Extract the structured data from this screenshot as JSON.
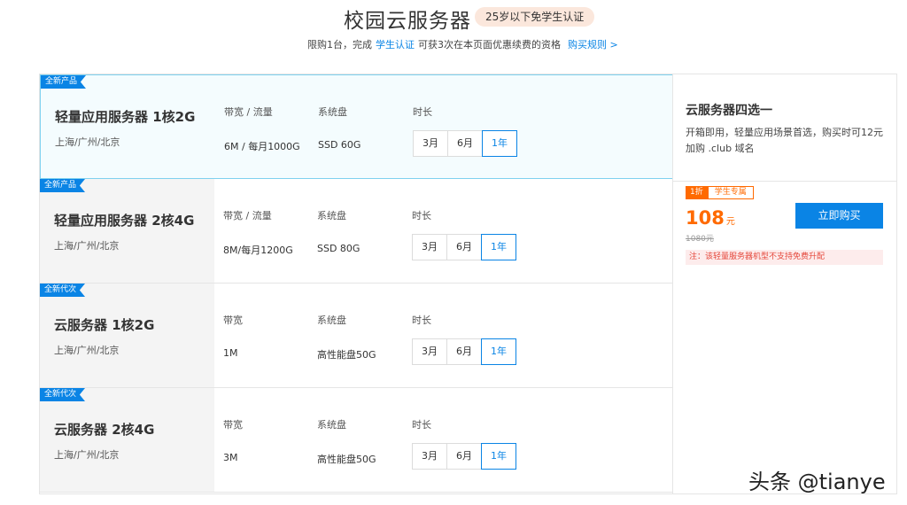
{
  "header": {
    "title": "校园云服务器",
    "badge": "25岁以下免学生认证",
    "subtitle_prefix": "限购1台，完成",
    "subtitle_link": "学生认证",
    "subtitle_middle": "可获3次在本页面优惠续费的资格",
    "subtitle_rules": "购买规则 >"
  },
  "products": [
    {
      "tag": "全新产品",
      "name": "轻量应用服务器 1核2G",
      "region": "上海/广州/北京",
      "bw_label": "带宽 / 流量",
      "bw_value": "6M / 每月1000G",
      "disk_label": "系统盘",
      "disk_value": "SSD 60G",
      "dur_label": "时长",
      "durations": [
        "3月",
        "6月",
        "1年"
      ]
    },
    {
      "tag": "全新产品",
      "name": "轻量应用服务器 2核4G",
      "region": "上海/广州/北京",
      "bw_label": "带宽 / 流量",
      "bw_value": "8M/每月1200G",
      "disk_label": "系统盘",
      "disk_value": "SSD 80G",
      "dur_label": "时长",
      "durations": [
        "3月",
        "6月",
        "1年"
      ]
    },
    {
      "tag": "全新代次",
      "name": "云服务器 1核2G",
      "region": "上海/广州/北京",
      "bw_label": "带宽",
      "bw_value": "1M",
      "disk_label": "系统盘",
      "disk_value": "高性能盘50G",
      "dur_label": "时长",
      "durations": [
        "3月",
        "6月",
        "1年"
      ]
    },
    {
      "tag": "全新代次",
      "name": "云服务器 2核4G",
      "region": "上海/广州/北京",
      "bw_label": "带宽",
      "bw_value": "3M",
      "disk_label": "系统盘",
      "disk_value": "高性能盘50G",
      "dur_label": "时长",
      "durations": [
        "3月",
        "6月",
        "1年"
      ]
    }
  ],
  "side": {
    "title": "云服务器四选一",
    "desc": "开箱即用，轻量应用场景首选，购买时可12元加购 .club 域名",
    "discount": "1折",
    "student": "学生专属",
    "price": "108",
    "price_unit": "元",
    "original": "1080元",
    "buy": "立即购买",
    "note": "注：该轻量服务器机型不支持免费升配"
  },
  "watermark": "头条 @tianye",
  "colors": {
    "accent": "#0a84e5",
    "price": "#ff6a00",
    "selected_border": "#7fd1ef"
  }
}
